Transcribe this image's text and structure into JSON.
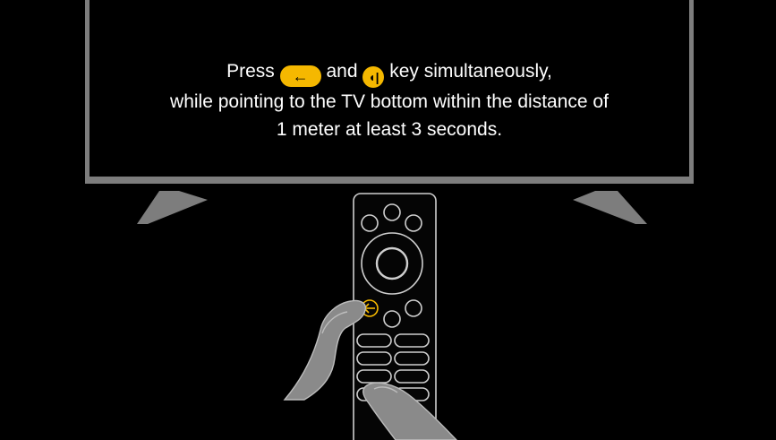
{
  "instruction": {
    "line1_pre": "Press",
    "line1_mid": "and",
    "line1_post": "key simultaneously,",
    "line2": "while pointing to the TV bottom within the distance of",
    "line3": "1 meter at least 3 seconds."
  },
  "keys": {
    "back_key_icon": "←",
    "volume_key_icon": "◖|"
  },
  "colors": {
    "background": "#000000",
    "tv_frame": "#7d7d7d",
    "accent_key": "#f5b800",
    "text": "#ffffff"
  }
}
